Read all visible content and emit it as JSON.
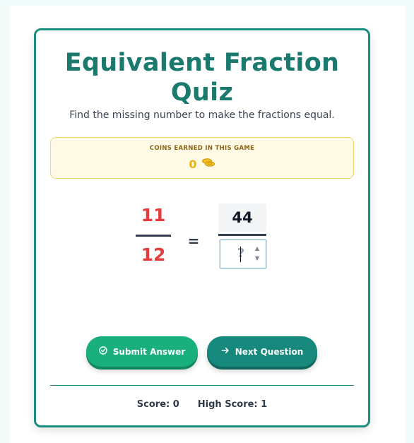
{
  "quiz": {
    "title": "Equivalent Fraction Quiz",
    "subtitle": "Find the missing number to make the fractions equal."
  },
  "coins": {
    "label": "COINS EARNED IN THIS GAME",
    "value": "0",
    "icon": "coins-icon"
  },
  "fraction_left": {
    "numerator": "11",
    "denominator": "12"
  },
  "equals_sign": "=",
  "fraction_right": {
    "numerator": "44",
    "answer_value": "",
    "answer_placeholder": "?"
  },
  "buttons": {
    "submit_label": "Submit Answer",
    "submit_icon": "check-circle-icon",
    "next_label": "Next Question",
    "next_icon": "arrow-right-icon"
  },
  "score": {
    "score_text": "Score: 0",
    "high_score_text": "High Score: 1"
  },
  "colors": {
    "accent": "#1a7a6e",
    "submit": "#19b07e",
    "next": "#17897c",
    "fraction_red": "#e53d3d",
    "coin_gold": "#e9b30f"
  }
}
